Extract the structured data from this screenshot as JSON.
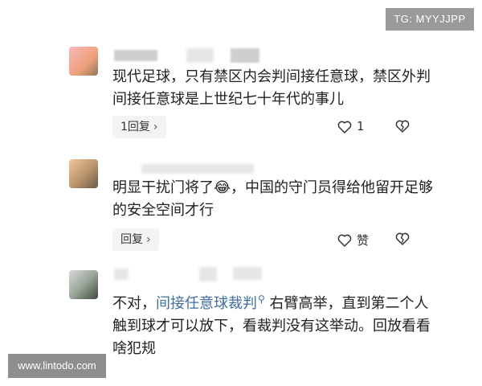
{
  "watermarks": {
    "top_right": "TG: MYYJJPP",
    "bottom_left": "www.lintodo.com"
  },
  "comments": [
    {
      "text": "现代足球，只有禁区内会判间接任意球，禁区外判间接任意球是上世纪七十年代的事儿",
      "reply_label": "1回复",
      "like_label": "1"
    },
    {
      "text_before": "明显干扰门将了",
      "emoji": "😂",
      "text_after": "，中国的守门员得给他留开足够的安全空间才行",
      "reply_label": "回复",
      "like_label": "赞"
    },
    {
      "text_prefix": "不对，",
      "link_text": "间接任意球裁判",
      "text_suffix": "右臂高举，直到第二个人触到球才可以放下，看裁判没有这举动。回放看看啥犯规"
    }
  ],
  "icon_names": [
    "heart-icon",
    "broken-heart-icon",
    "search-icon",
    "chevron-right-icon"
  ]
}
